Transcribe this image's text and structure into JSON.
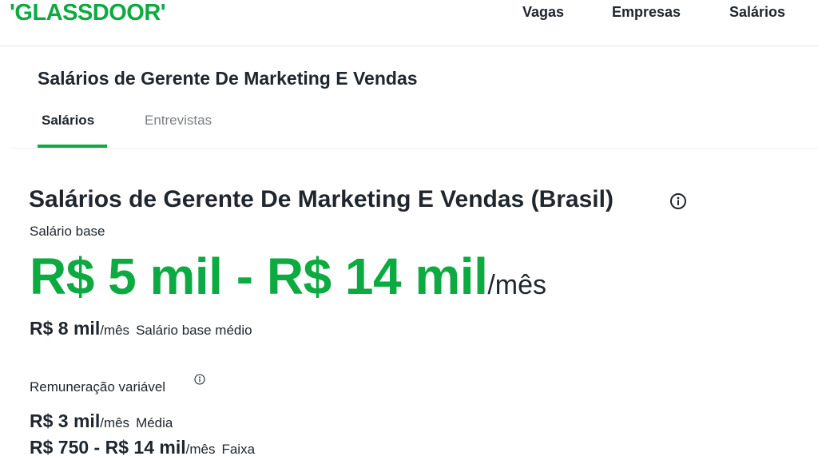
{
  "brand": {
    "logo_text": "'GLASSDOOR'",
    "color": "#0caa41"
  },
  "nav": {
    "items": [
      {
        "label": "Vagas"
      },
      {
        "label": "Empresas"
      },
      {
        "label": "Salários"
      }
    ]
  },
  "header": {
    "title": "Salários de Gerente De Marketing E Vendas"
  },
  "tabs": [
    {
      "label": "Salários",
      "active": true
    },
    {
      "label": "Entrevistas",
      "active": false
    }
  ],
  "salary": {
    "section_title": "Salários de Gerente De Marketing E Vendas (Brasil)",
    "info_icon": "info-icon",
    "base_label": "Salário base",
    "range": "R$ 5 mil - R$ 14 mil",
    "range_unit": "/mês",
    "average_amount": "R$ 8 mil",
    "average_unit": "/mês",
    "average_label": "Salário base médio"
  },
  "variable": {
    "label": "Remuneração variável",
    "info_icon": "info-icon",
    "average_amount": "R$ 3 mil",
    "average_unit": "/mês",
    "average_label": "Média",
    "range_amount": "R$ 750 - R$ 14 mil",
    "range_unit": "/mês",
    "range_label": "Faixa"
  },
  "colors": {
    "accent": "#0caa41",
    "text": "#20262e",
    "muted": "#7b7f84"
  }
}
